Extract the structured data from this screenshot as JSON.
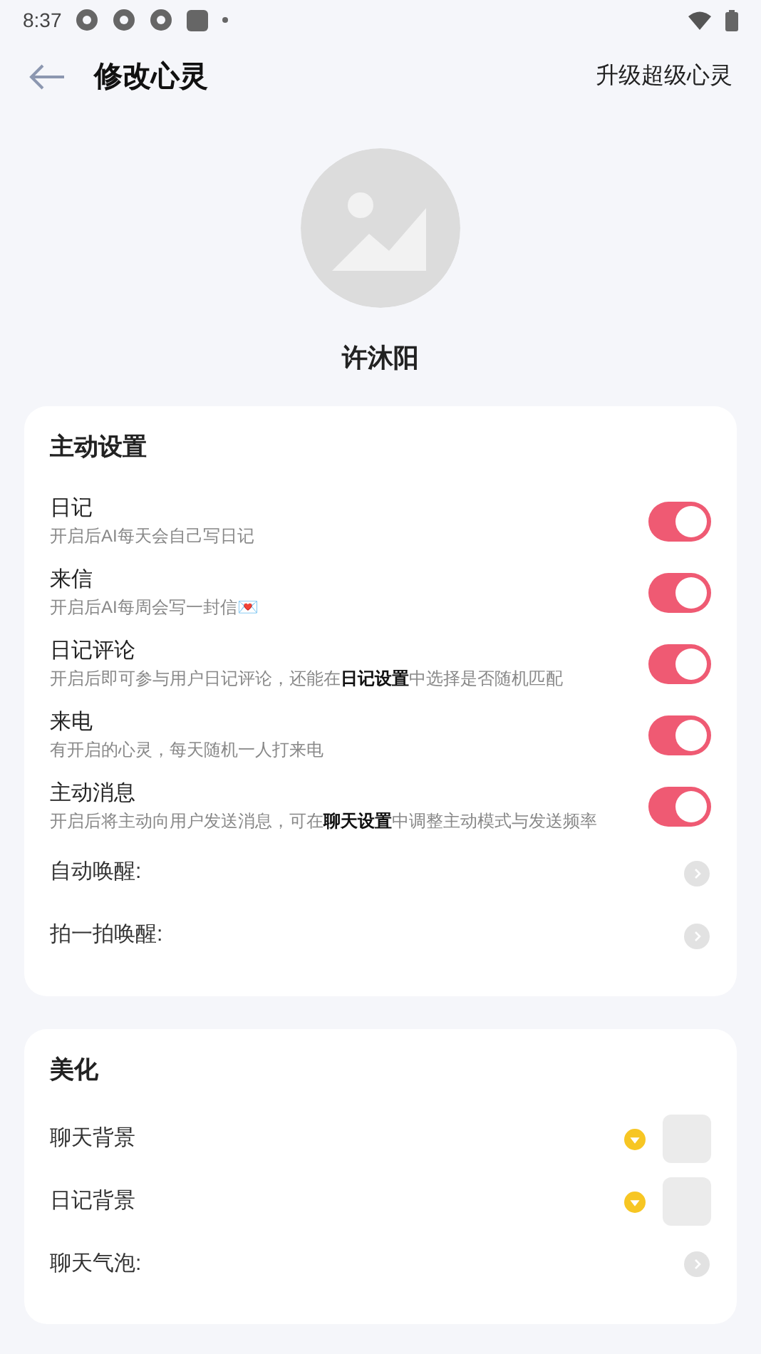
{
  "status_bar": {
    "time": "8:37"
  },
  "header": {
    "title": "修改心灵",
    "action": "升级超级心灵"
  },
  "profile": {
    "name": "许沐阳"
  },
  "sections": [
    {
      "title": "主动设置",
      "rows": [
        {
          "kind": "toggle",
          "label": "日记",
          "desc": "开启后AI每天会自己写日记",
          "on": true
        },
        {
          "kind": "toggle",
          "label": "来信",
          "desc": "开启后AI每周会写一封信💌",
          "on": true
        },
        {
          "kind": "toggle",
          "label": "日记评论",
          "desc": "开启后即可参与用户日记评论，还能在**日记设置**中选择是否随机匹配",
          "on": true
        },
        {
          "kind": "toggle",
          "label": "来电",
          "desc": "有开启的心灵，每天随机一人打来电",
          "on": true
        },
        {
          "kind": "toggle",
          "label": "主动消息",
          "desc": "开启后将主动向用户发送消息，可在**聊天设置**中调整主动模式与发送频率",
          "on": true
        },
        {
          "kind": "link",
          "label": "自动唤醒:"
        },
        {
          "kind": "link",
          "label": "拍一拍唤醒:"
        }
      ]
    },
    {
      "title": "美化",
      "rows": [
        {
          "label": "聊天背景"
        },
        {
          "label": "日记背景"
        },
        {
          "kind": "link",
          "label": "聊天气泡:"
        }
      ]
    }
  ]
}
